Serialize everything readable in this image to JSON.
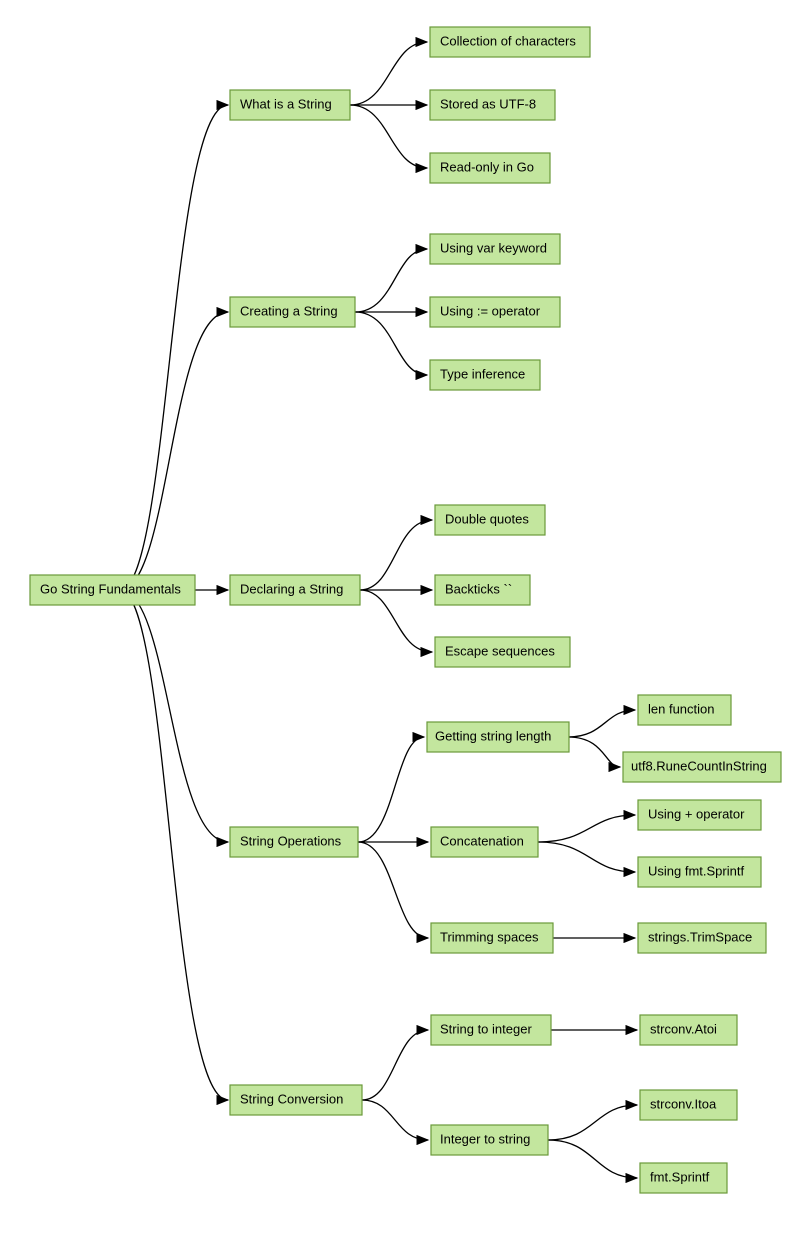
{
  "chart_data": {
    "type": "mindmap",
    "root": "Go String Fundamentals",
    "children": [
      {
        "label": "What is a String",
        "children": [
          {
            "label": "Collection of characters"
          },
          {
            "label": "Stored as UTF-8"
          },
          {
            "label": "Read-only in Go"
          }
        ]
      },
      {
        "label": "Creating a String",
        "children": [
          {
            "label": "Using var keyword"
          },
          {
            "label": "Using := operator"
          },
          {
            "label": "Type inference"
          }
        ]
      },
      {
        "label": "Declaring a String",
        "children": [
          {
            "label": "Double quotes"
          },
          {
            "label": "Backticks ``"
          },
          {
            "label": "Escape sequences"
          }
        ]
      },
      {
        "label": "String Operations",
        "children": [
          {
            "label": "Getting string length",
            "children": [
              {
                "label": "len function"
              },
              {
                "label": "utf8.RuneCountInString"
              }
            ]
          },
          {
            "label": "Concatenation",
            "children": [
              {
                "label": "Using + operator"
              },
              {
                "label": "Using fmt.Sprintf"
              }
            ]
          },
          {
            "label": "Trimming spaces",
            "children": [
              {
                "label": "strings.TrimSpace"
              }
            ]
          }
        ]
      },
      {
        "label": "String Conversion",
        "children": [
          {
            "label": "String to integer",
            "children": [
              {
                "label": "strconv.Atoi"
              }
            ]
          },
          {
            "label": "Integer to string",
            "children": [
              {
                "label": "strconv.Itoa"
              },
              {
                "label": "fmt.Sprintf"
              }
            ]
          }
        ]
      }
    ]
  },
  "nodes": {
    "root": "Go String Fundamentals",
    "b1": "What is a String",
    "b1c1": "Collection of characters",
    "b1c2": "Stored as UTF-8",
    "b1c3": "Read-only in Go",
    "b2": "Creating a String",
    "b2c1": "Using var keyword",
    "b2c2": "Using := operator",
    "b2c3": "Type inference",
    "b3": "Declaring a String",
    "b3c1": "Double quotes",
    "b3c2": "Backticks ``",
    "b3c3": "Escape sequences",
    "b4": "String Operations",
    "b4c1": "Getting string length",
    "b4c1a": "len function",
    "b4c1b": "utf8.RuneCountInString",
    "b4c2": "Concatenation",
    "b4c2a": "Using + operator",
    "b4c2b": "Using fmt.Sprintf",
    "b4c3": "Trimming spaces",
    "b4c3a": "strings.TrimSpace",
    "b5": "String Conversion",
    "b5c1": "String to integer",
    "b5c1a": "strconv.Atoi",
    "b5c2": "Integer to string",
    "b5c2a": "strconv.Itoa",
    "b5c2b": "fmt.Sprintf"
  },
  "colors": {
    "nodeFill": "#c3e69e",
    "nodeStroke": "#6a9a3a",
    "edge": "#000000"
  }
}
